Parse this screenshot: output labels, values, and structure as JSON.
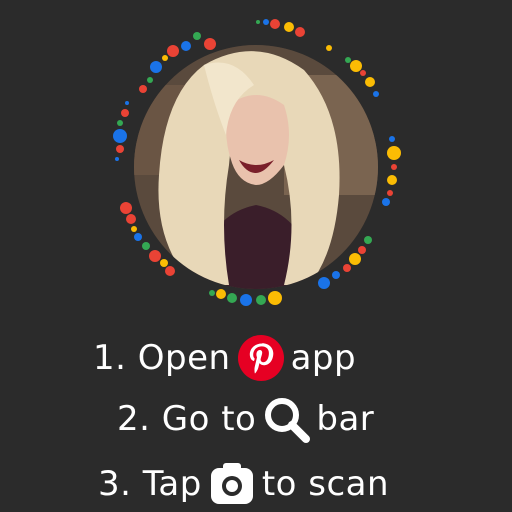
{
  "steps": [
    {
      "number": "1.",
      "before": "Open",
      "icon": "pinterest-logo-icon",
      "after": "app"
    },
    {
      "number": "2.",
      "before": "Go to",
      "icon": "search-icon",
      "after": "bar"
    },
    {
      "number": "3.",
      "before": "Tap",
      "icon": "camera-icon",
      "after": "to scan"
    }
  ],
  "colors": {
    "background": "#2b2b2b",
    "text": "#ffffff",
    "pinterest_red": "#e60023",
    "dot_red": "#ea4335",
    "dot_blue": "#1a73e8",
    "dot_yellow": "#fbbc04",
    "dot_green": "#34a853"
  }
}
